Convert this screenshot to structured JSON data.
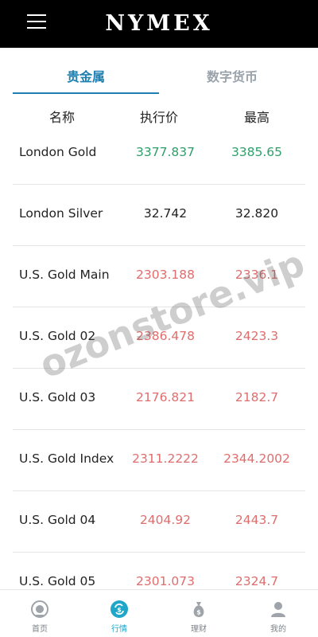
{
  "header": {
    "brand": "NYMEX"
  },
  "tabs": [
    {
      "label": "贵金属",
      "active": true
    },
    {
      "label": "数字货币",
      "active": false
    }
  ],
  "table": {
    "columns": [
      "名称",
      "执行价",
      "最高"
    ],
    "rows": [
      {
        "name": "London Gold",
        "strike": "3377.837",
        "high": "3385.65",
        "color": "#2f9e6a"
      },
      {
        "name": "London Silver",
        "strike": "32.742",
        "high": "32.820",
        "color": "#222222"
      },
      {
        "name": "U.S. Gold Main",
        "strike": "2303.188",
        "high": "2336.1",
        "color": "#e06d6d"
      },
      {
        "name": "U.S. Gold 02",
        "strike": "2386.478",
        "high": "2423.3",
        "color": "#e06d6d"
      },
      {
        "name": "U.S. Gold 03",
        "strike": "2176.821",
        "high": "2182.7",
        "color": "#e06d6d"
      },
      {
        "name": "U.S. Gold Index",
        "strike": "2311.2222",
        "high": "2344.2002",
        "color": "#e06d6d"
      },
      {
        "name": "U.S. Gold 04",
        "strike": "2404.92",
        "high": "2443.7",
        "color": "#e06d6d"
      },
      {
        "name": "U.S. Gold 05",
        "strike": "2301.073",
        "high": "2324.7",
        "color": "#e06d6d"
      }
    ]
  },
  "watermark": "ozonstore.vip",
  "bottom_nav": [
    {
      "label": "首页",
      "icon": "home-icon",
      "active": false
    },
    {
      "label": "行情",
      "icon": "market-icon",
      "active": true
    },
    {
      "label": "理财",
      "icon": "money-bag-icon",
      "active": false
    },
    {
      "label": "我的",
      "icon": "profile-icon",
      "active": false
    }
  ],
  "colors": {
    "accent": "#1f7fb1",
    "up": "#e06d6d",
    "down": "#2f9e6a",
    "nav_active": "#1ea7c8"
  }
}
